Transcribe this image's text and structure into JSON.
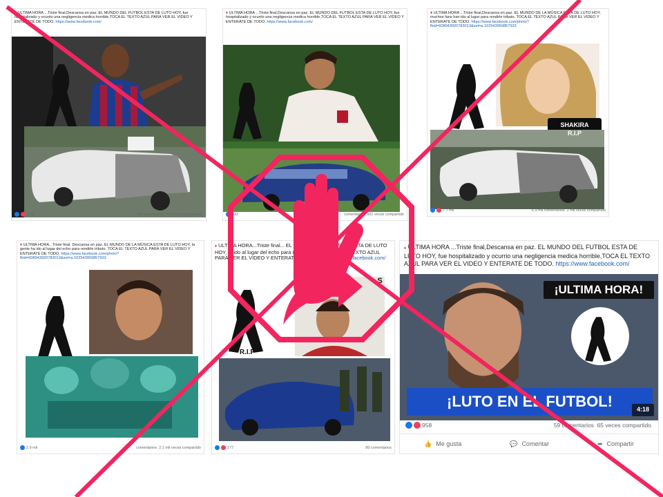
{
  "colors": {
    "accent": "#f2255f",
    "link": "#1a5fb4",
    "like": "#1877f2",
    "love": "#f33e58"
  },
  "posts": [
    {
      "text": "ULTIMA HORA ...Triste final,Descansa en paz. EL MUNDO DEL FUTBOL ESTA DE LUTO HOY, fue hospitalizado y ocurrio una negligencia medica horrible,TOCA EL TEXTO AZUL PARA VER EL VIDEO Y ENTERATE DE TODO.",
      "link": "https://www.facebook.com/",
      "reactions": "2 mil",
      "comments": "158 comentarios",
      "shares": "118 veces compartido"
    },
    {
      "text": "ULTIMA HORA ...Triste final,Descansa en paz. EL MUNDO DEL FUTBOL ESTA DE LUTO HOY, fue hospitalizado y ocurrio una negligencia medica horrible,TOCA EL TEXTO AZUL PARA VER EL VIDEO Y ENTERATE DE TODO.",
      "link": "https://www.facebook.com/",
      "reactions": "832",
      "comments": "comentarios",
      "shares": "321 veces compartido"
    },
    {
      "text": "ULTIMA HORA ...Triste final,Descansa en paz. EL MUNDO DE LA MÚSICA ESTA DE LUTO HOY, muchos fans han ido al lugar para rendirle tributo. TOCA EL TEXTO AZUL PARA VER EL VIDEO Y ENTERATE DE TODO.",
      "link": "https://www.facebook.com/photo?fbid=608943920783013&set=a.102543959857933",
      "reactions": "7.7 mil",
      "comments": "6.9 mil comentarios",
      "shares": "2 mil veces compartido",
      "tag": "SHAKIRA",
      "tag2": "R.I.P"
    },
    {
      "text": "ULTIMA HORA...Triste final. Descansa en paz. EL MUNDO DE LA MÚSICA ESTA DE LUTO HOY, la gente ha ido al lugar del echo para rendirle tributo. TOCA EL TEXTO AZUL PARA VER EL VIDEO Y ENTERATE DE TODO.",
      "link": "https://www.facebook.com/photo?fbid=608943920783013&set=a.102543959857933",
      "reactions": "2.9 mil",
      "comments": "comentarios",
      "shares": "2.1 mil veces compartido"
    },
    {
      "text": "ULTIMA HORA...Triste final... EL MUNDO DE LA MUSICA ESTA DE LUTO HOY, ... ido al lugar del echo para rendirle tributo,TOCA EL TEXTO AZUL PARA VER EL VIDEO Y ENTERATE DE TODO.",
      "link": "https://www.facebook.com/",
      "reactions": "177",
      "comments": "80 comentarios",
      "shares": "",
      "tag": "R.I.P",
      "tag2": "S"
    },
    {
      "text": "ULTIMA HORA ...Triste final,Descansa en paz. EL MUNDO DEL FUTBOL ESTA DE LUTO HOY, fue hospitalizado y ocurrio una negligencia medica horrible,TOCA EL TEXTO AZUL PARA VER EL VIDEO Y ENTERATE DE TODO.",
      "link": "https://www.facebook.com/",
      "reactions": "958",
      "comments": "59 comentarios",
      "shares": "65 veces compartido",
      "banner_top": "¡ULTIMA HORA!",
      "banner_bottom": "¡LUTO EN EL FUTBOL!",
      "duration": "4:18",
      "like_label": "Me gusta",
      "comment_label": "Comentar",
      "share_label": "Compartir"
    }
  ]
}
